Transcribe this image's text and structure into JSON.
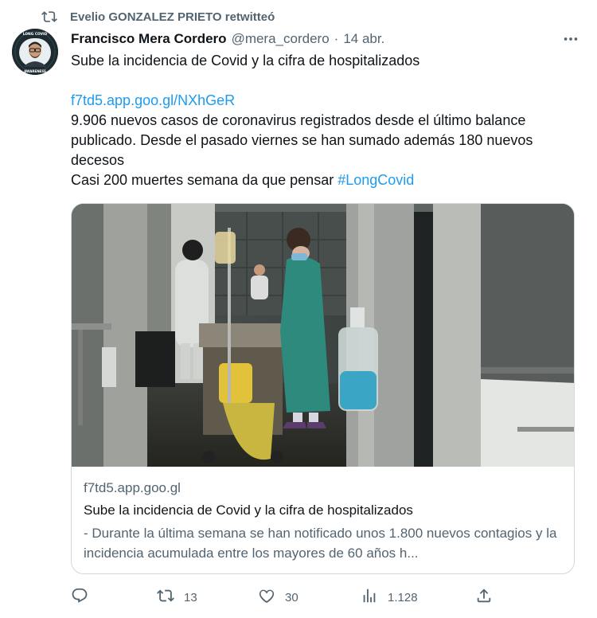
{
  "retweet": {
    "icon": "retweet-icon",
    "text": "Evelio GONZALEZ PRIETO retwitteó"
  },
  "tweet": {
    "author_name": "Francisco Mera Cordero",
    "author_handle": "@mera_cordero",
    "separator": "·",
    "date": "14 abr.",
    "avatar_badge_top": "LONG COVID",
    "avatar_badge_bottom": "AWARENESS",
    "text_lines": [
      "Sube la incidencia de Covid y la cifra de hospitalizados",
      "",
      "f7td5.app.goo.gl/NXhGeR",
      " 9.906 nuevos casos de coronavirus registrados desde el último balance",
      "publicado. Desde el pasado viernes se han sumado además 180 nuevos",
      "decesos",
      "Casi 200 muertes semana  da que pensar "
    ],
    "hashtag": "#LongCovid"
  },
  "card": {
    "domain": "f7td5.app.goo.gl",
    "title": "Sube la incidencia de Covid y la cifra de hospitalizados",
    "description": "- Durante la última semana se han notificado unos 1.800 nuevos contagios y la incidencia acumulada entre los mayores de 60 años h..."
  },
  "actions": {
    "reply_count": "",
    "retweet_count": "13",
    "like_count": "30",
    "views_count": "1.128"
  },
  "colors": {
    "link": "#1d9bf0",
    "secondary_text": "#536471",
    "primary_text": "#0f1419",
    "border": "#cfd9de"
  }
}
